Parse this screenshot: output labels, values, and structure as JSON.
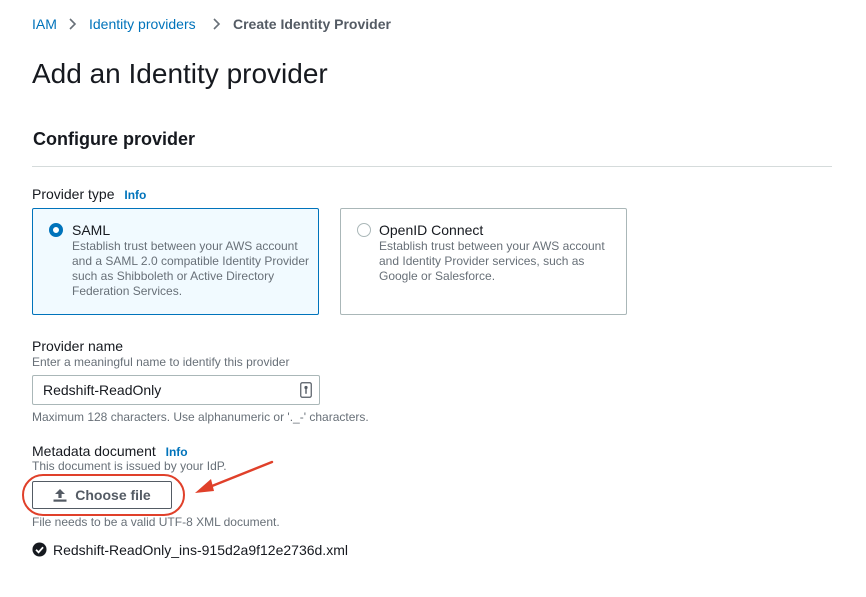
{
  "breadcrumb": {
    "items": [
      "IAM",
      "Identity providers",
      "Create Identity Provider"
    ]
  },
  "page": {
    "title": "Add an Identity provider",
    "section_title": "Configure provider"
  },
  "provider_type": {
    "label": "Provider type",
    "info": "Info",
    "options": [
      {
        "label": "SAML",
        "description": "Establish trust between your AWS account and a SAML 2.0 compatible Identity Provider such as Shibboleth or Active Directory Federation Services.",
        "selected": true
      },
      {
        "label": "OpenID Connect",
        "description": "Establish trust between your AWS account and Identity Provider services, such as Google or Salesforce.",
        "selected": false
      }
    ]
  },
  "provider_name": {
    "label": "Provider name",
    "description": "Enter a meaningful name to identify this provider",
    "value": "Redshift-ReadOnly",
    "constraint": "Maximum 128 characters. Use alphanumeric or '._-' characters."
  },
  "metadata": {
    "label": "Metadata document",
    "info": "Info",
    "description": "This document is issued by your IdP.",
    "button_label": "Choose file",
    "constraint": "File needs to be a valid UTF-8 XML document.",
    "file_name": "Redshift-ReadOnly_ins-915d2a9f12e2736d.xml"
  },
  "colors": {
    "link": "#0073bb",
    "selected_tile_bg": "#f1faff",
    "annotation": "#e0402a"
  },
  "icons": {
    "breadcrumb_separator": "chevron-right-icon",
    "upload": "upload-icon",
    "success": "status-success-icon",
    "input_key": "key-icon"
  }
}
